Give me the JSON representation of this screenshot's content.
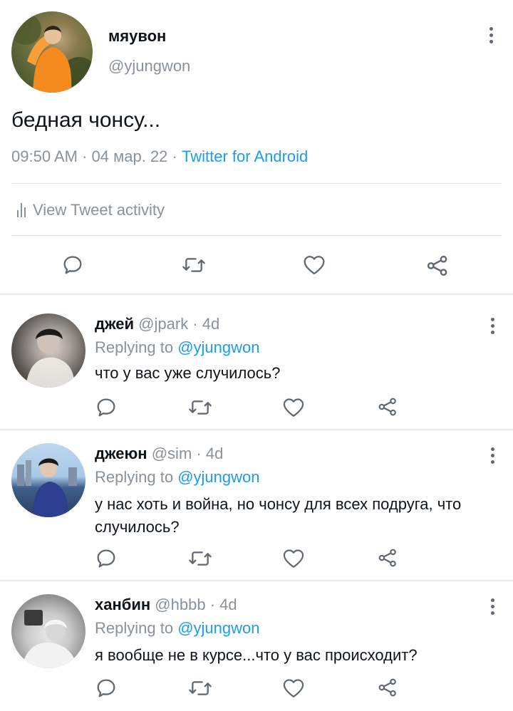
{
  "main_tweet": {
    "author_name": "мяувон",
    "author_handle": "@yjungwon",
    "text": "бедная чонсу...",
    "time": "09:50 AM",
    "date": "04 мар. 22",
    "separator": "·",
    "client": "Twitter for Android",
    "activity_label": "View Tweet activity"
  },
  "replies": [
    {
      "name": "джей",
      "handle": "@jpark",
      "age": "4d",
      "replying_prefix": "Replying to",
      "replying_to": "@yjungwon",
      "text": "что у вас уже случилось?"
    },
    {
      "name": "джеюн",
      "handle": "@sim",
      "age": "4d",
      "replying_prefix": "Replying to",
      "replying_to": "@yjungwon",
      "text": "у нас хоть и война, но чонсу для всех подруга, что случилось?"
    },
    {
      "name": "ханбин",
      "handle": "@hbbb",
      "age": "4d",
      "replying_prefix": "Replying to",
      "replying_to": "@yjungwon",
      "text": "я вообще не в курсе...что у вас происходит?"
    }
  ],
  "icons": {
    "reply": "speech-bubble-icon",
    "retweet": "retweet-icon",
    "like": "heart-icon",
    "share": "share-icon",
    "more": "more-vertical-icon",
    "activity": "bar-chart-icon"
  },
  "colors": {
    "link": "#1d9bf0",
    "secondary_text": "#8a9299",
    "icon": "#5f6770",
    "divider": "#dfe3e6"
  }
}
